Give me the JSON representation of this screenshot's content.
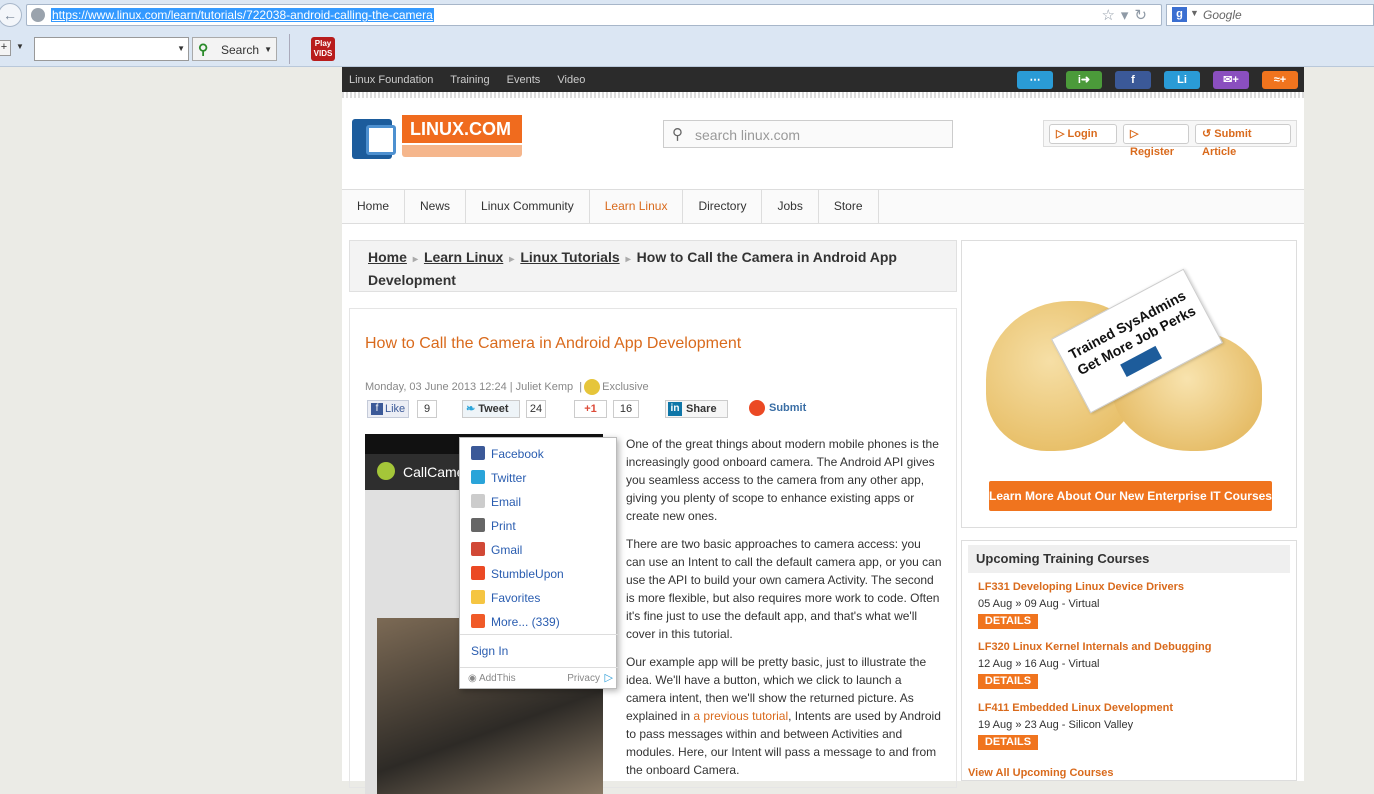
{
  "browser": {
    "url": "https://www.linux.com/learn/tutorials/722038-android-calling-the-camera",
    "search_placeholder": "Google",
    "toolbar_search_label": "Search",
    "playvids_label": "Play VIDS"
  },
  "site": {
    "top_links": [
      "Linux Foundation",
      "Training",
      "Events",
      "Video"
    ],
    "logo_text": "LINUX.COM",
    "search_placeholder": "search linux.com",
    "account": {
      "login": "Login",
      "register": "Register",
      "submit": "Submit Article"
    },
    "nav": [
      "Home",
      "News",
      "Linux Community",
      "Learn Linux",
      "Directory",
      "Jobs",
      "Store"
    ],
    "nav_active": "Learn Linux",
    "breadcrumb": {
      "home": "Home",
      "learn": "Learn Linux",
      "tutorials": "Linux Tutorials",
      "current": "How to Call the Camera in Android App Development"
    }
  },
  "article": {
    "title": "How to Call the Camera in Android App Development",
    "date": "Monday, 03 June 2013 12:24",
    "author": "Juliet Kemp",
    "exclusive": "Exclusive",
    "share": {
      "like": "Like",
      "like_count": "9",
      "tweet": "Tweet",
      "tweet_count": "24",
      "gplus": "+1",
      "gplus_count": "16",
      "linkedin": "Share",
      "submit": "Submit"
    },
    "phone_app_title": "CallCame",
    "paragraph1": "One of the great things about modern mobile phones is the increasingly good onboard camera. The Android API gives you seamless access to the camera from any other app, giving you plenty of scope to enhance existing apps or create new ones.",
    "paragraph2": "There are two basic approaches to camera access: you can use an Intent to call the default camera app, or you can use the API to build your own camera Activity. The second is more flexible, but also requires more work to code. Often it's fine just to use the default app, and that's what we'll cover in this tutorial.",
    "paragraph3_before": "Our example app will be pretty basic, just to illustrate the idea. We'll have a button, which we click to launch a camera intent, then we'll show the returned picture. As explained in ",
    "paragraph3_link": "a previous tutorial",
    "paragraph3_after": ", Intents are used by Android to pass messages within and between Activities and modules. Here, our Intent will pass a message to and from the onboard Camera."
  },
  "share_popup": {
    "items": [
      "Facebook",
      "Twitter",
      "Email",
      "Print",
      "Gmail",
      "StumbleUpon",
      "Favorites",
      "More... (339)"
    ],
    "icon_colors": [
      "#3b5998",
      "#2aa4d9",
      "#cccccc",
      "#666666",
      "#d14836",
      "#eb4924",
      "#f5c542",
      "#f05a28"
    ],
    "sign_in": "Sign In",
    "brand": "AddThis",
    "privacy": "Privacy"
  },
  "ad": {
    "card_line1": "Trained SysAdmins",
    "card_line2": "Get More Job Perks",
    "cta": "Learn More About Our New Enterprise IT Courses"
  },
  "training": {
    "heading": "Upcoming Training Courses",
    "courses": [
      {
        "title": "LF331 Developing Linux Device Drivers",
        "dates": "05 Aug » 09 Aug - Virtual",
        "button": "DETAILS"
      },
      {
        "title": "LF320 Linux Kernel Internals and Debugging",
        "dates": "12 Aug » 16 Aug - Virtual",
        "button": "DETAILS"
      },
      {
        "title": "LF411 Embedded Linux Development",
        "dates": "19 Aug » 23 Aug - Silicon Valley",
        "button": "DETAILS"
      }
    ],
    "view_all": "View All Upcoming Courses"
  },
  "colors": {
    "accent": "#d96a1c",
    "link": "#2a5db0",
    "topbar": "#2b2b2b"
  }
}
